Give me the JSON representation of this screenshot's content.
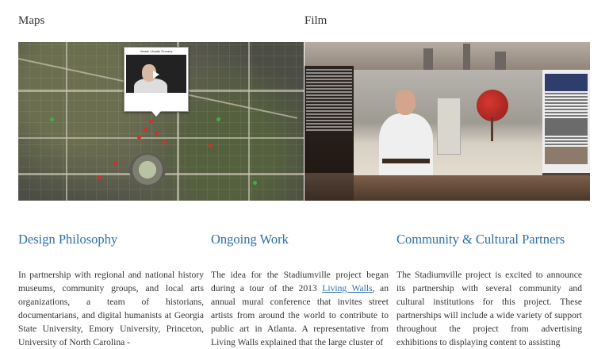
{
  "sections": {
    "maps_label": "Maps",
    "film_label": "Film"
  },
  "map_popup": {
    "title": "Jessie / Austin Grocery"
  },
  "columns": [
    {
      "heading": "Design Philosophy",
      "text": "In partnership with regional and national history museums, community groups, and local arts organizations, a team of historians, documentarians, and digital humanists at Georgia State University, Emory University, Princeton, University of North Carolina -"
    },
    {
      "heading": "Ongoing Work",
      "text_before_link": "The idea for the Stadiumville project began during a tour of the 2013 ",
      "link_text": "Living Walls",
      "text_after_link": ", an annual mural conference that invites street artists from around the world to contribute to public art in Atlanta. A representative from Living Walls explained that the large cluster of"
    },
    {
      "heading": "Community & Cultural Partners",
      "text": "The Stadiumville project is excited to announce its partnership with several community and cultural institutions for this project. These partnerships will include a wide variety of support throughout the project from advertising exhibitions to displaying content to assisting"
    }
  ],
  "colors": {
    "heading": "#2f6fa8",
    "body_text": "#333333",
    "link": "#2f6fa8"
  },
  "icons": [
    "play-icon",
    "map-marker-icon"
  ]
}
